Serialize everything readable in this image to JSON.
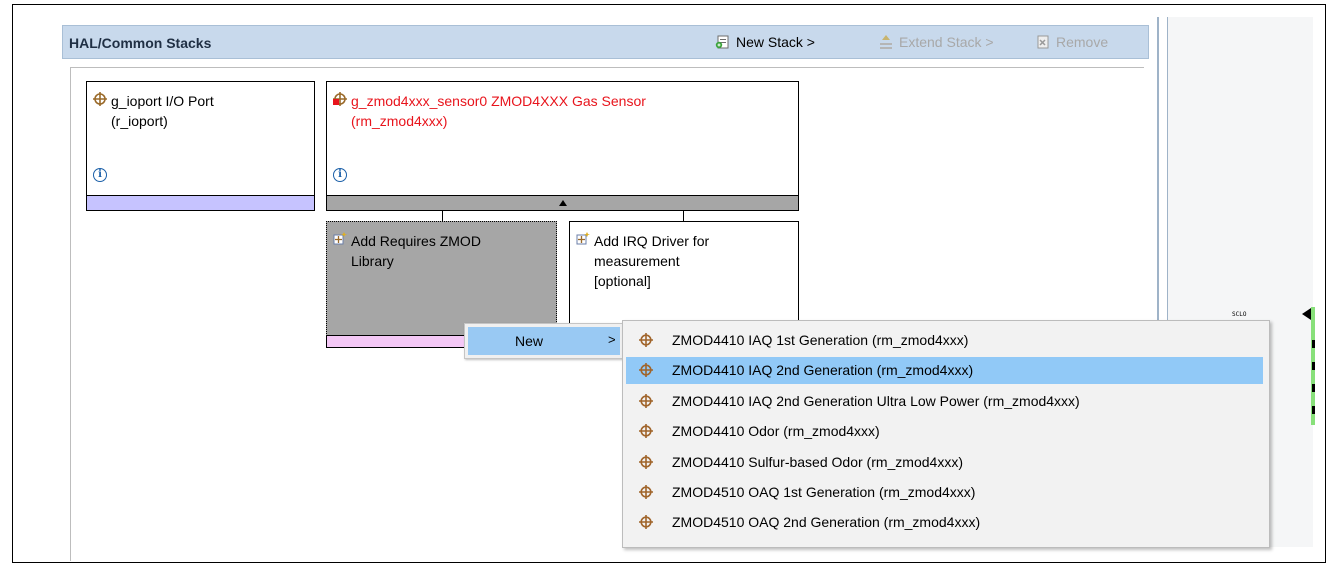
{
  "panel": {
    "title": "HAL/Common Stacks",
    "toolbar": {
      "new_stack": "New Stack >",
      "extend_stack": "Extend Stack >",
      "remove": "Remove"
    }
  },
  "modules": {
    "ioport": {
      "line1": "g_ioport I/O Port",
      "line2": "(r_ioport)",
      "info": "i"
    },
    "zmod": {
      "line1": "g_zmod4xxx_sensor0 ZMOD4XXX Gas Sensor",
      "line2": "(rm_zmod4xxx)",
      "info": "i"
    },
    "add_lib": {
      "line1": "Add Requires ZMOD",
      "line2": "Library"
    },
    "add_irq": {
      "line1": "Add IRQ Driver for",
      "line2": "measurement",
      "line3": "[optional]"
    }
  },
  "context_menu": {
    "new_label": "New",
    "arrow": ">"
  },
  "submenu": {
    "items": [
      {
        "label": "ZMOD4410 IAQ 1st Generation (rm_zmod4xxx)",
        "highlighted": false
      },
      {
        "label": "ZMOD4410 IAQ 2nd Generation (rm_zmod4xxx)",
        "highlighted": true
      },
      {
        "label": "ZMOD4410 IAQ 2nd Generation Ultra Low Power (rm_zmod4xxx)",
        "highlighted": false
      },
      {
        "label": "ZMOD4410 Odor (rm_zmod4xxx)",
        "highlighted": false
      },
      {
        "label": "ZMOD4410 Sulfur-based Odor (rm_zmod4xxx)",
        "highlighted": false
      },
      {
        "label": "ZMOD4510 OAQ 1st Generation (rm_zmod4xxx)",
        "highlighted": false
      },
      {
        "label": "ZMOD4510 OAQ 2nd Generation (rm_zmod4xxx)",
        "highlighted": false
      }
    ]
  },
  "right_panel": {
    "pin_label": "SCLO"
  },
  "colors": {
    "header_bg": "#c8d9ec",
    "error_text": "#e8141c",
    "highlight": "#91c9f7",
    "lavender_bar": "#c6c3ff",
    "pink_bar": "#f4c8f6"
  }
}
